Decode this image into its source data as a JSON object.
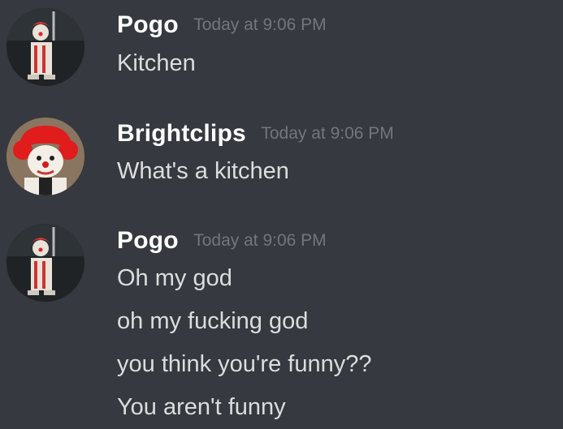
{
  "messages": [
    {
      "username": "Pogo",
      "timestamp": "Today at 9:06 PM",
      "lines": [
        "Kitchen"
      ]
    },
    {
      "username": "Brightclips",
      "timestamp": "Today at 9:06 PM",
      "lines": [
        "What's a kitchen"
      ]
    },
    {
      "username": "Pogo",
      "timestamp": "Today at 9:06 PM",
      "lines": [
        "Oh my god",
        "oh my fucking god",
        "you think you're funny??",
        "You aren't funny"
      ]
    }
  ],
  "colors": {
    "background": "#36393f",
    "username": "#ffffff",
    "timestamp": "#72767d",
    "message_text": "#dcddde"
  }
}
